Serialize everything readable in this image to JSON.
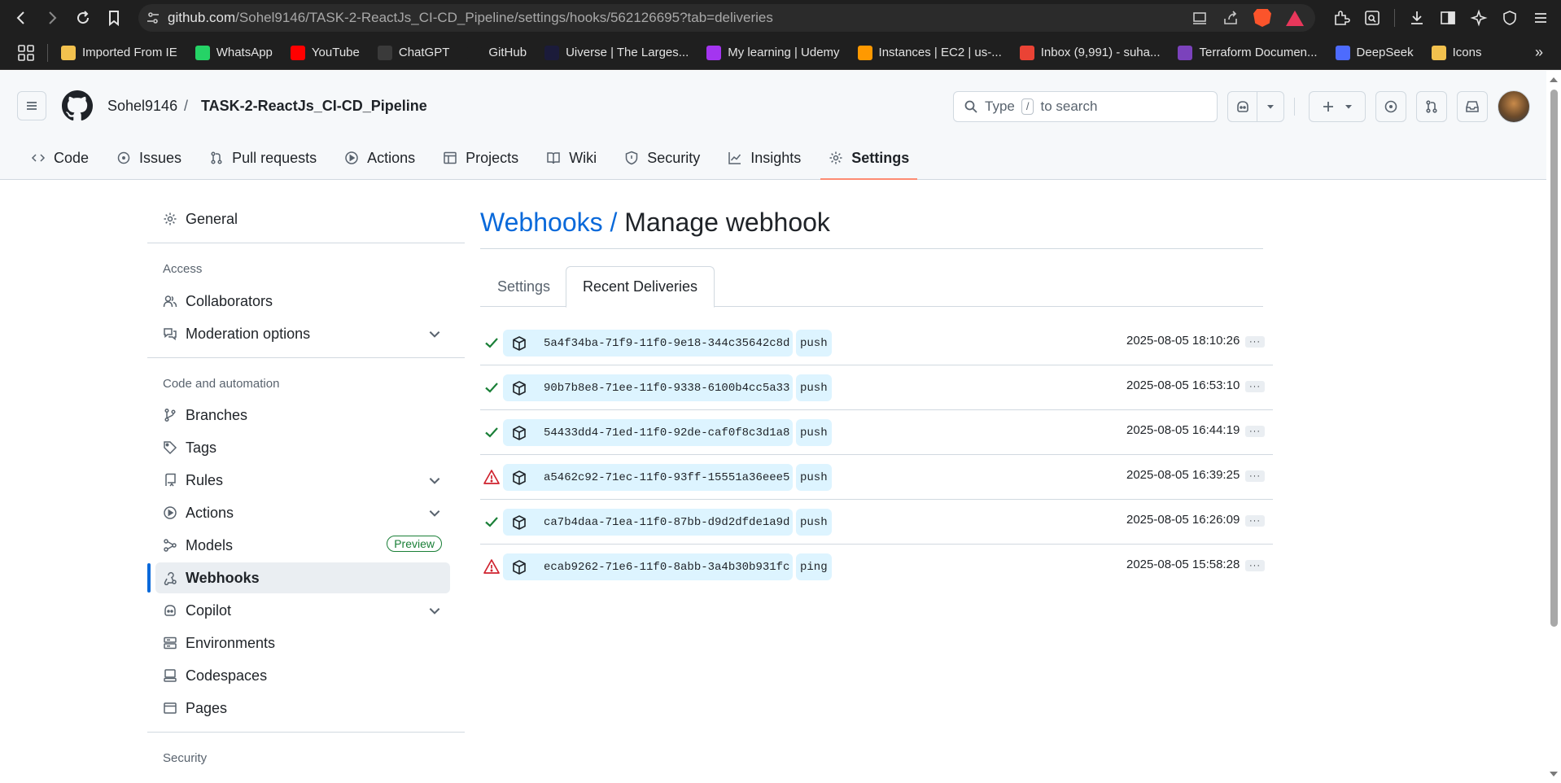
{
  "browser": {
    "url_host": "github.com",
    "url_path": "/Sohel9146/TASK-2-ReactJs_CI-CD_Pipeline/settings/hooks/562126695?tab=deliveries",
    "bookmarks": [
      {
        "label": "Imported From IE",
        "color": "#f2c14e"
      },
      {
        "label": "WhatsApp",
        "color": "#25d366"
      },
      {
        "label": "YouTube",
        "color": "#ff0000"
      },
      {
        "label": "ChatGPT",
        "color": "#3a3a3a"
      },
      {
        "label": "GitHub",
        "color": "#1f1f1f"
      },
      {
        "label": "Uiverse | The Larges...",
        "color": "#1b1b3a"
      },
      {
        "label": "My learning | Udemy",
        "color": "#a435f0"
      },
      {
        "label": "Instances | EC2 | us-...",
        "color": "#ff9900"
      },
      {
        "label": "Inbox (9,991) - suha...",
        "color": "#ea4335"
      },
      {
        "label": "Terraform Documen...",
        "color": "#7b42bc"
      },
      {
        "label": "DeepSeek",
        "color": "#4d6bfe"
      },
      {
        "label": "Icons",
        "color": "#f2c14e"
      }
    ]
  },
  "header": {
    "owner": "Sohel9146",
    "separator": "/",
    "repo": "TASK-2-ReactJs_CI-CD_Pipeline",
    "search_prefix": "Type",
    "search_key": "/",
    "search_suffix": "to search"
  },
  "repo_tabs": [
    {
      "label": "Code",
      "icon": "code-icon"
    },
    {
      "label": "Issues",
      "icon": "issue-icon"
    },
    {
      "label": "Pull requests",
      "icon": "pull-request-icon"
    },
    {
      "label": "Actions",
      "icon": "play-icon"
    },
    {
      "label": "Projects",
      "icon": "table-icon"
    },
    {
      "label": "Wiki",
      "icon": "book-icon"
    },
    {
      "label": "Security",
      "icon": "shield-icon"
    },
    {
      "label": "Insights",
      "icon": "graph-icon"
    },
    {
      "label": "Settings",
      "icon": "gear-icon",
      "active": true
    }
  ],
  "sidebar": {
    "general": "General",
    "access_heading": "Access",
    "collaborators": "Collaborators",
    "moderation": "Moderation options",
    "code_heading": "Code and automation",
    "branches": "Branches",
    "tags": "Tags",
    "rules": "Rules",
    "actions": "Actions",
    "models": "Models",
    "models_badge": "Preview",
    "webhooks": "Webhooks",
    "copilot": "Copilot",
    "environments": "Environments",
    "codespaces": "Codespaces",
    "pages": "Pages",
    "security_heading": "Security"
  },
  "main": {
    "title_link": "Webhooks",
    "title_sep": " / ",
    "title_rest": "Manage webhook",
    "tab_settings": "Settings",
    "tab_deliveries": "Recent Deliveries",
    "more_label": "···",
    "deliveries": [
      {
        "status": "success",
        "guid": "5a4f34ba-71f9-11f0-9e18-344c35642c8d",
        "event": "push",
        "delivered_at": "2025-08-05 18:10:26"
      },
      {
        "status": "success",
        "guid": "90b7b8e8-71ee-11f0-9338-6100b4cc5a33",
        "event": "push",
        "delivered_at": "2025-08-05 16:53:10"
      },
      {
        "status": "success",
        "guid": "54433dd4-71ed-11f0-92de-caf0f8c3d1a8",
        "event": "push",
        "delivered_at": "2025-08-05 16:44:19"
      },
      {
        "status": "failure",
        "guid": "a5462c92-71ec-11f0-93ff-15551a36eee5",
        "event": "push",
        "delivered_at": "2025-08-05 16:39:25"
      },
      {
        "status": "success",
        "guid": "ca7b4daa-71ea-11f0-87bb-d9d2dfde1a9d",
        "event": "push",
        "delivered_at": "2025-08-05 16:26:09"
      },
      {
        "status": "failure",
        "guid": "ecab9262-71e6-11f0-8abb-3a4b30b931fc",
        "event": "ping",
        "delivered_at": "2025-08-05 15:58:28"
      }
    ]
  }
}
